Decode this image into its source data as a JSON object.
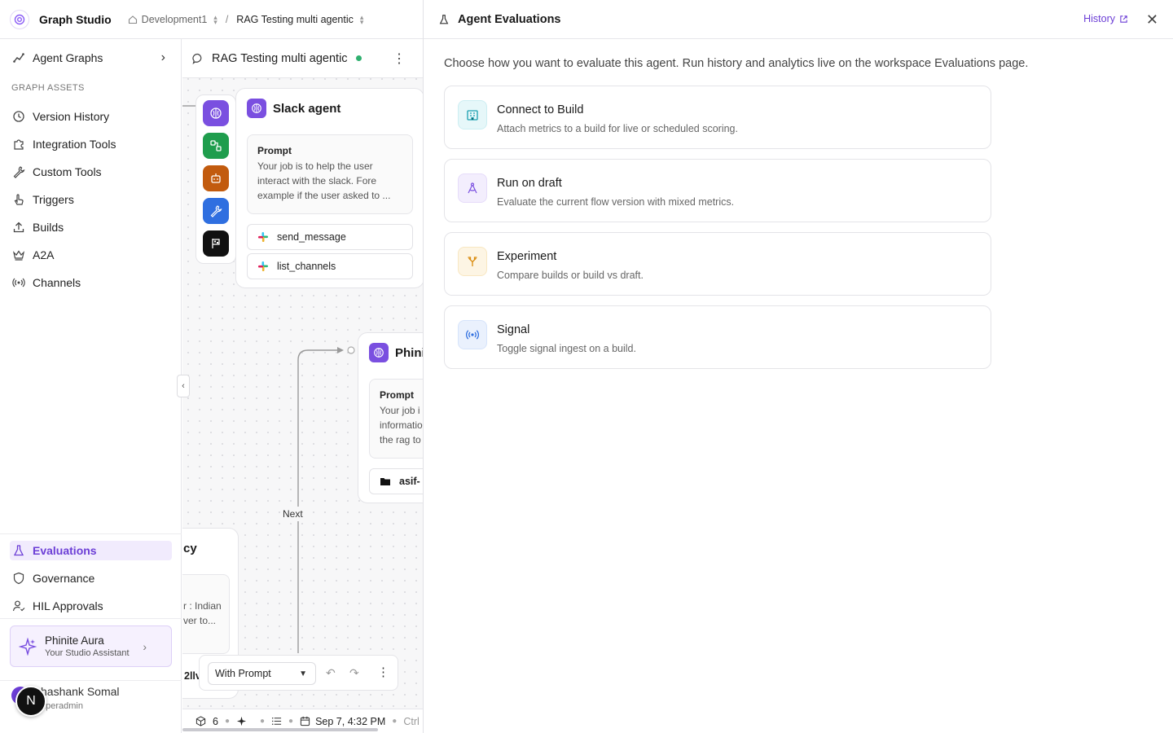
{
  "topbar": {
    "app_title": "Graph Studio",
    "workspace": "Development1",
    "separator": "/",
    "graph_name": "RAG Testing multi agentic"
  },
  "sidebar": {
    "agent_graphs": "Agent Graphs",
    "section_heading": "GRAPH ASSETS",
    "items": [
      {
        "label": "Version History",
        "icon": "history-icon"
      },
      {
        "label": "Integration Tools",
        "icon": "puzzle-icon"
      },
      {
        "label": "Custom Tools",
        "icon": "wrench-icon"
      },
      {
        "label": "Triggers",
        "icon": "pointer-icon"
      },
      {
        "label": "Builds",
        "icon": "upload-icon"
      },
      {
        "label": "A2A",
        "icon": "crown-icon"
      },
      {
        "label": "Channels",
        "icon": "broadcast-icon"
      }
    ],
    "bottom_items": [
      {
        "label": "Evaluations",
        "icon": "flask-icon",
        "active": true
      },
      {
        "label": "Governance",
        "icon": "shield-icon"
      },
      {
        "label": "HIL Approvals",
        "icon": "user-check-icon"
      }
    ],
    "assistant": {
      "name": "Phinite Aura",
      "subtitle": "Your Studio Assistant"
    },
    "user": {
      "name": "hashank Somal",
      "role": "uperadmin",
      "badge": "N"
    }
  },
  "canvas": {
    "title": "RAG Testing multi agentic",
    "status_color": "#2fb06f",
    "slack_node": {
      "title": "Slack agent",
      "prompt_label": "Prompt",
      "prompt_text": "Your job is to help the user interact with the slack. Fore example if the user asked to ...",
      "tools": [
        "send_message",
        "list_channels"
      ]
    },
    "phinite_node": {
      "title": "Phini",
      "prompt_label": "Prompt",
      "prompt_text": "Your job i informatio the rag to",
      "tool": "asif-"
    },
    "left_node": {
      "title": "cy",
      "prompt_text": "r : Indian ver to...",
      "tool": "2llv"
    },
    "edge_label": "Next",
    "mode_select": "With Prompt",
    "status": {
      "count": "6",
      "date": "Sep 7, 4:32 PM",
      "shortcut": "Ctrl"
    }
  },
  "panel": {
    "title": "Agent Evaluations",
    "history_link": "History",
    "intro": "Choose how you want to evaluate this agent. Run history and analytics live on the workspace Evaluations page.",
    "options": [
      {
        "title": "Connect to Build",
        "desc": "Attach metrics to a build for live or scheduled scoring.",
        "icon": "building-icon",
        "color": "#1a9fb0",
        "bg": "#e6f7f9"
      },
      {
        "title": "Run on draft",
        "desc": "Evaluate the current flow version with mixed metrics.",
        "icon": "compass-icon",
        "color": "#7a4fe0",
        "bg": "#f3eefd"
      },
      {
        "title": "Experiment",
        "desc": "Compare builds or build vs draft.",
        "icon": "split-icon",
        "color": "#d98a0b",
        "bg": "#fdf5e4"
      },
      {
        "title": "Signal",
        "desc": "Toggle signal ingest on a build.",
        "icon": "signal-icon",
        "color": "#2f6fe0",
        "bg": "#eaf1fd"
      }
    ]
  },
  "colors": {
    "accent": "#6c3ed6"
  }
}
